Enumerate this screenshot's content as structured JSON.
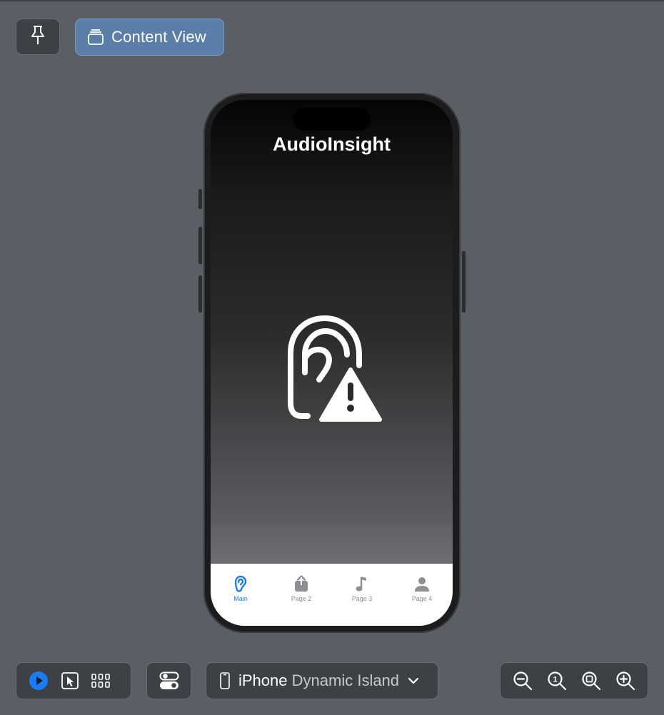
{
  "toolbar": {
    "pin_icon": "pin-icon",
    "content_view_label": "Content View",
    "content_view_icon": "stack-icon"
  },
  "app": {
    "title": "AudioInsight",
    "hero_icon": "ear-warning-icon",
    "tabs": [
      {
        "label": "Main",
        "icon": "ear-icon",
        "active": true
      },
      {
        "label": "Page 2",
        "icon": "share-icon",
        "active": false
      },
      {
        "label": "Page 3",
        "icon": "music-note-icon",
        "active": false
      },
      {
        "label": "Page 4",
        "icon": "person-icon",
        "active": false
      }
    ]
  },
  "bottom": {
    "device_name": "iPhone",
    "device_variant": "Dynamic Island",
    "mode_buttons": [
      "live-play-icon",
      "select-cursor-icon",
      "variants-grid-icon"
    ],
    "settings_icon": "device-settings-icon",
    "zoom_buttons": [
      "zoom-out-icon",
      "zoom-actual-icon",
      "zoom-fit-icon",
      "zoom-in-icon"
    ]
  },
  "colors": {
    "accent": "#1a7cf5",
    "canvas": "#5a5f66",
    "selected_button": "#5b7ea9"
  }
}
